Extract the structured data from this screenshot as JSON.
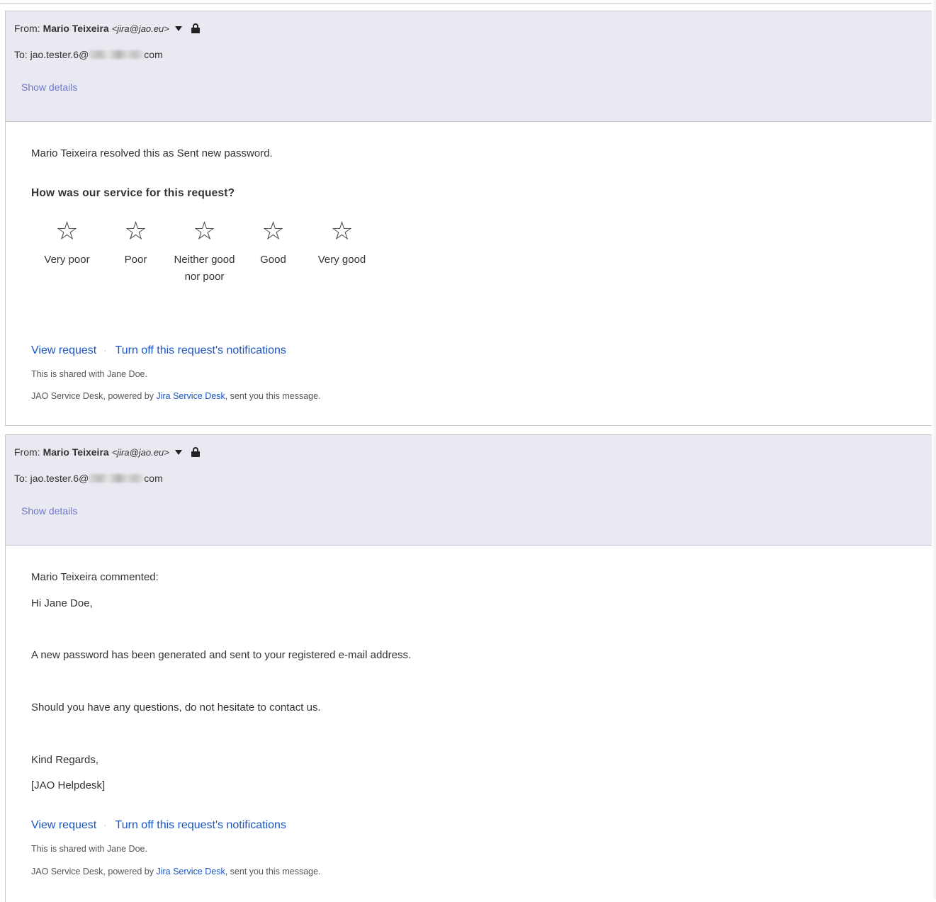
{
  "messages": [
    {
      "from_label": "From:",
      "from_name": "Mario Teixeira",
      "from_email": "<jira@jao.eu>",
      "to_label": "To:",
      "to_prefix": "jao.tester.6@",
      "to_suffix": "com",
      "show_details": "Show details",
      "body": {
        "resolved_text": "Mario Teixeira resolved this as Sent new password.",
        "question": "How was our service for this request?",
        "ratings": [
          {
            "glyph": "☆",
            "label": "Very poor"
          },
          {
            "glyph": "☆",
            "label": "Poor"
          },
          {
            "glyph": "☆",
            "label": "Neither good nor poor"
          },
          {
            "glyph": "☆",
            "label": "Good"
          },
          {
            "glyph": "☆",
            "label": "Very good"
          }
        ]
      },
      "footer": {
        "view_request": "View request",
        "separator": "·",
        "turn_off": "Turn off this request's notifications",
        "shared_text": "This is shared with Jane Doe.",
        "powered_prefix": "JAO Service Desk, powered by",
        "powered_link": "Jira Service Desk",
        "powered_suffix": ", sent you this message."
      }
    },
    {
      "from_label": "From:",
      "from_name": "Mario Teixeira",
      "from_email": "<jira@jao.eu>",
      "to_label": "To:",
      "to_prefix": "jao.tester.6@",
      "to_suffix": "com",
      "show_details": "Show details",
      "body": {
        "commented": "Mario Teixeira commented:",
        "greeting": "Hi Jane Doe,",
        "paragraph_1": "A new password has been generated and sent to your registered e-mail address.",
        "paragraph_2": "Should you have any questions, do not hesitate to contact us.",
        "closing": "Kind Regards,",
        "signature": "[JAO Helpdesk]"
      },
      "footer": {
        "view_request": "View request",
        "separator": "·",
        "turn_off": "Turn off this request's notifications",
        "shared_text": "This is shared with Jane Doe.",
        "powered_prefix": "JAO Service Desk, powered by",
        "powered_link": "Jira Service Desk",
        "powered_suffix": ", sent you this message."
      }
    }
  ],
  "icons": {
    "dropdown": "caret-down-icon",
    "security": "lock-icon",
    "rating": "star-outline-icon"
  }
}
